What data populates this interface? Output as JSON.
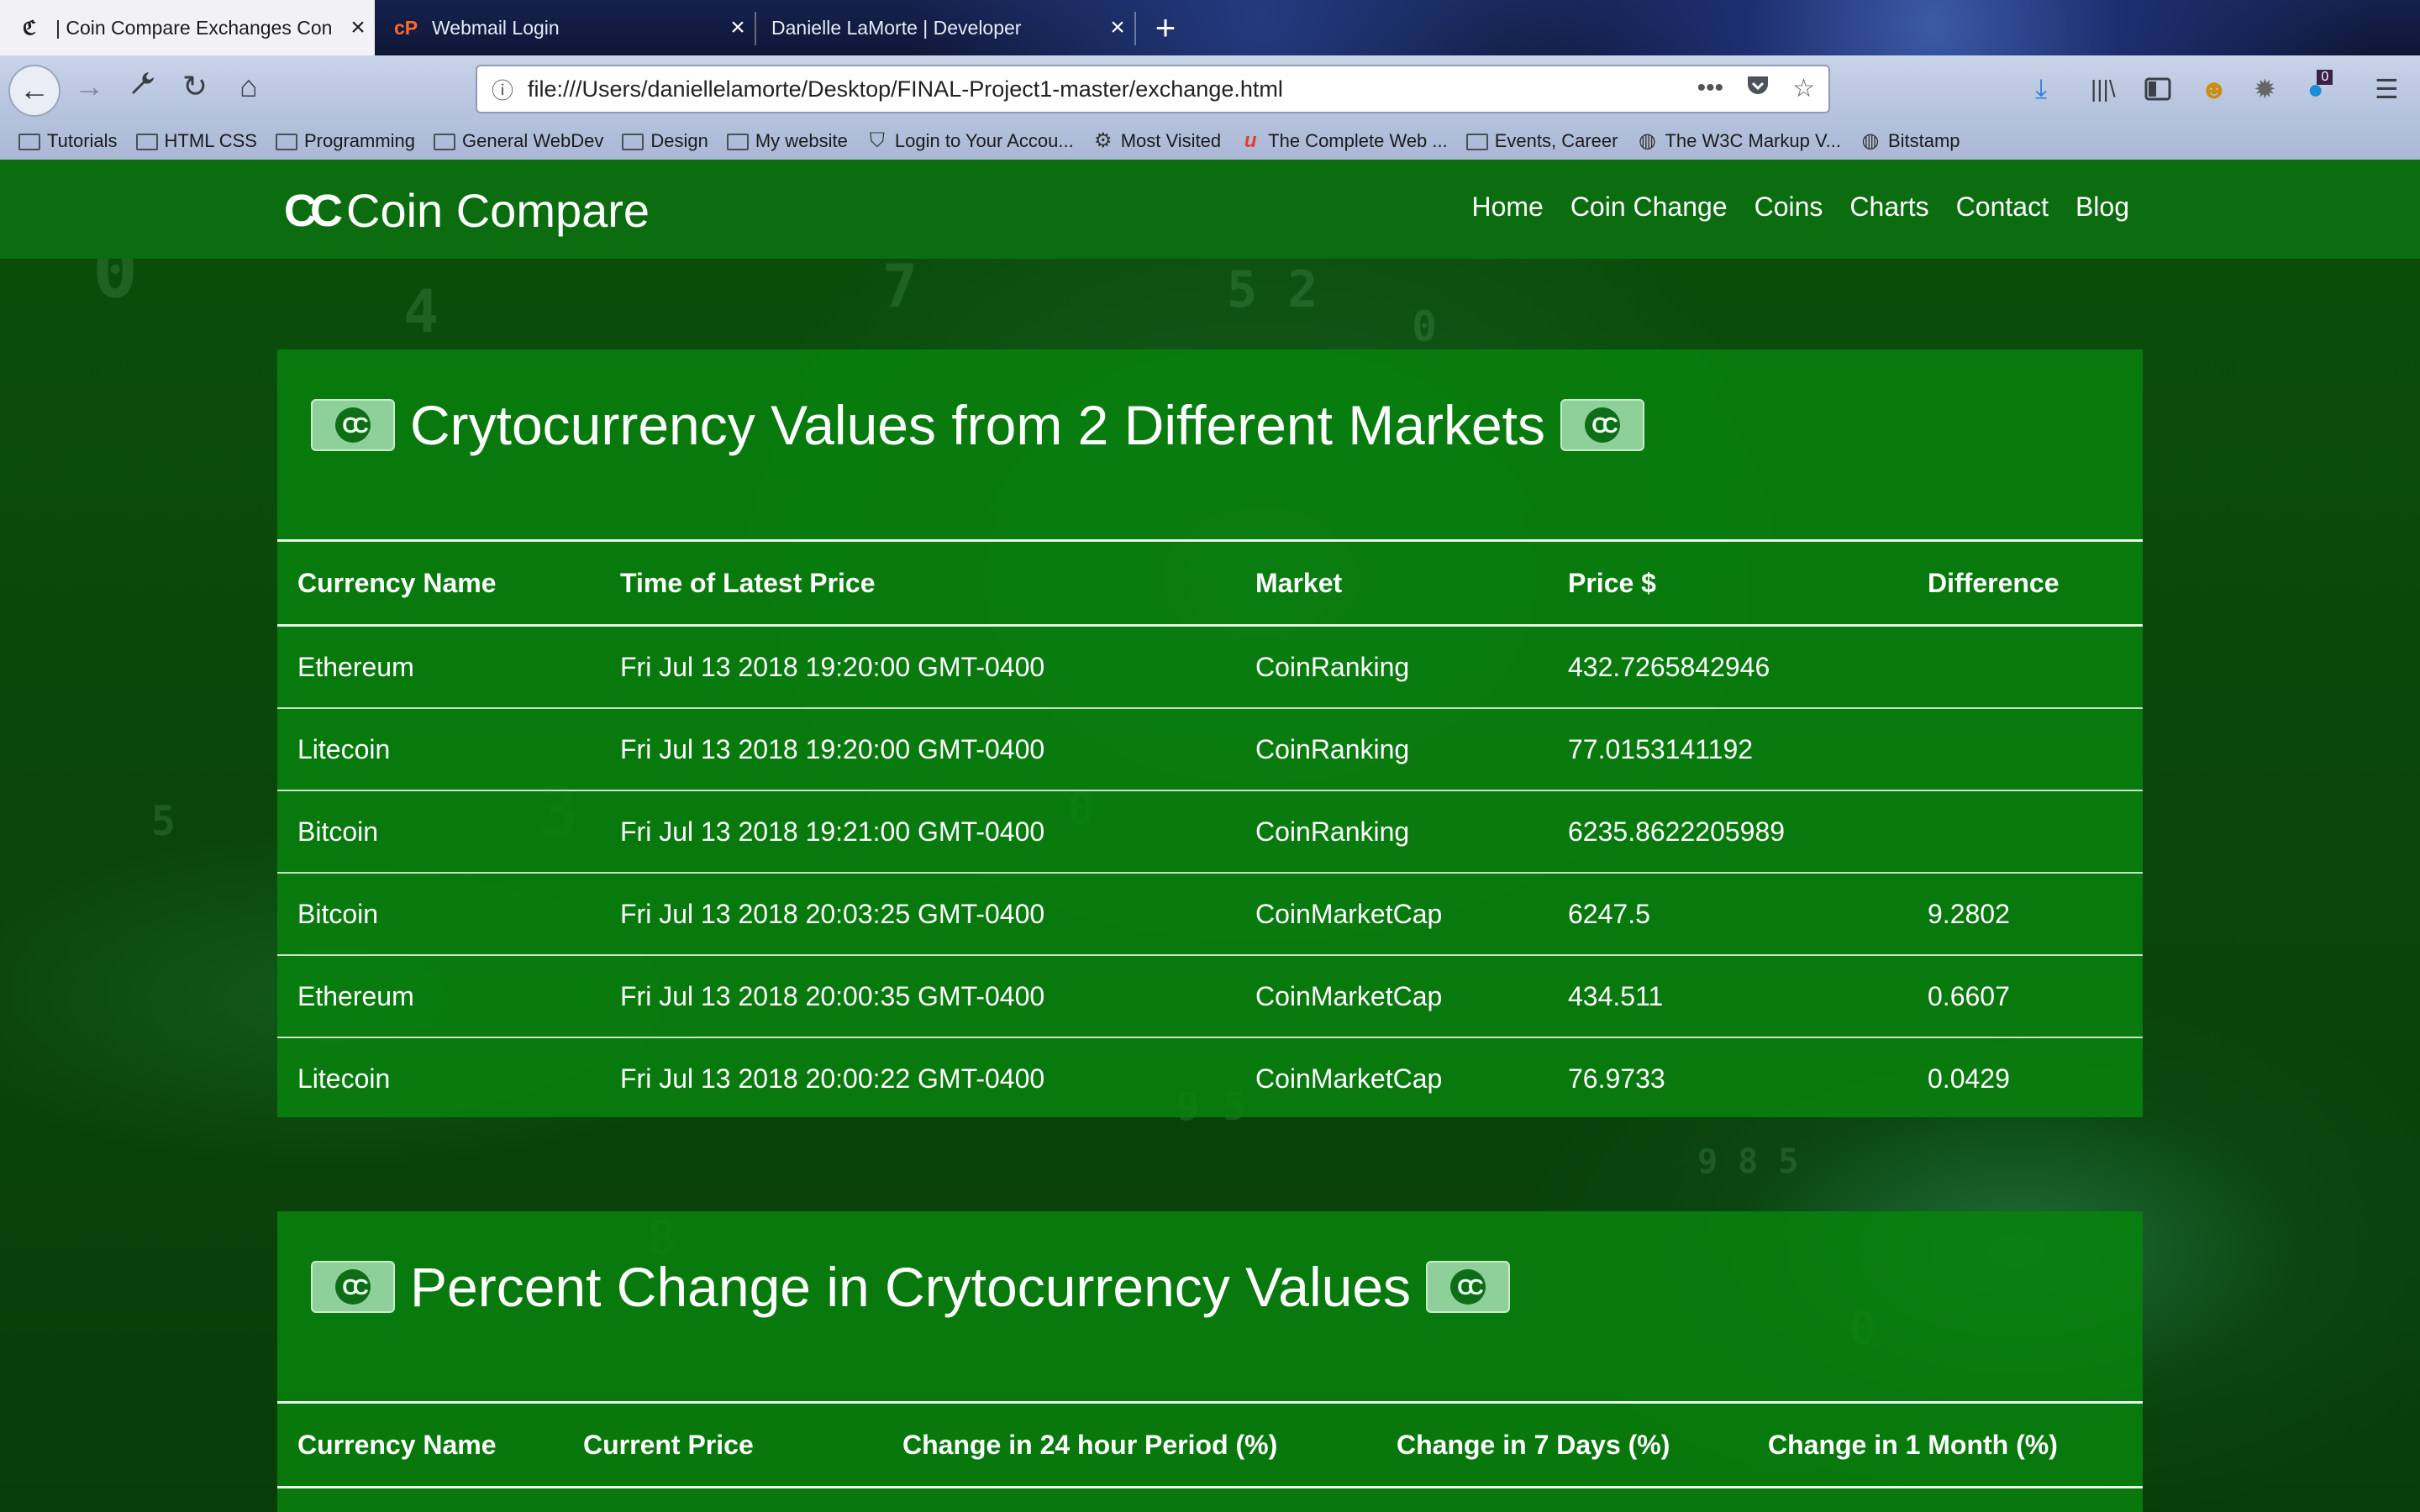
{
  "browser": {
    "tabs": [
      {
        "title": "| Coin Compare Exchanges Con",
        "active": true
      },
      {
        "title": "Webmail Login",
        "active": false
      },
      {
        "title": "Danielle LaMorte | Developer",
        "active": false
      }
    ],
    "url": "file:///Users/daniellelamorte/Desktop/FINAL-Project1-master/exchange.html",
    "notification_count": "0",
    "bookmarks": [
      {
        "label": "Tutorials",
        "icon": "folder-icon"
      },
      {
        "label": "HTML CSS",
        "icon": "folder-icon"
      },
      {
        "label": "Programming",
        "icon": "folder-icon"
      },
      {
        "label": "General WebDev",
        "icon": "folder-icon"
      },
      {
        "label": "Design",
        "icon": "folder-icon"
      },
      {
        "label": "My website",
        "icon": "folder-icon"
      },
      {
        "label": "Login to Your Accou...",
        "icon": "shield-icon"
      },
      {
        "label": "Most Visited",
        "icon": "gear-icon"
      },
      {
        "label": "The Complete Web ...",
        "icon": "udemy-icon"
      },
      {
        "label": "Events, Career",
        "icon": "folder-icon"
      },
      {
        "label": "The W3C Markup V...",
        "icon": "globe-icon"
      },
      {
        "label": "Bitstamp",
        "icon": "globe-icon"
      }
    ]
  },
  "site": {
    "brand": "Coin Compare",
    "nav": [
      "Home",
      "Coin Change",
      "Coins",
      "Charts",
      "Contact",
      "Blog"
    ]
  },
  "exchange_table": {
    "title": "Crytocurrency Values from 2 Different Markets",
    "headers": [
      "Currency Name",
      "Time of Latest Price",
      "Market",
      "Price $",
      "Difference"
    ],
    "rows": [
      [
        "Ethereum",
        "Fri Jul 13 2018 19:20:00 GMT-0400",
        "CoinRanking",
        "432.7265842946",
        ""
      ],
      [
        "Litecoin",
        "Fri Jul 13 2018 19:20:00 GMT-0400",
        "CoinRanking",
        "77.0153141192",
        ""
      ],
      [
        "Bitcoin",
        "Fri Jul 13 2018 19:21:00 GMT-0400",
        "CoinRanking",
        "6235.8622205989",
        ""
      ],
      [
        "Bitcoin",
        "Fri Jul 13 2018 20:03:25 GMT-0400",
        "CoinMarketCap",
        "6247.5",
        "9.2802"
      ],
      [
        "Ethereum",
        "Fri Jul 13 2018 20:00:35 GMT-0400",
        "CoinMarketCap",
        "434.511",
        "0.6607"
      ],
      [
        "Litecoin",
        "Fri Jul 13 2018 20:00:22 GMT-0400",
        "CoinMarketCap",
        "76.9733",
        "0.0429"
      ]
    ]
  },
  "percent_table": {
    "title": "Percent Change in Crytocurrency Values",
    "headers": [
      "Currency Name",
      "Current Price",
      "Change in 24 hour Period (%)",
      "Change in 7 Days (%)",
      "Change in 1 Month (%)"
    ]
  }
}
